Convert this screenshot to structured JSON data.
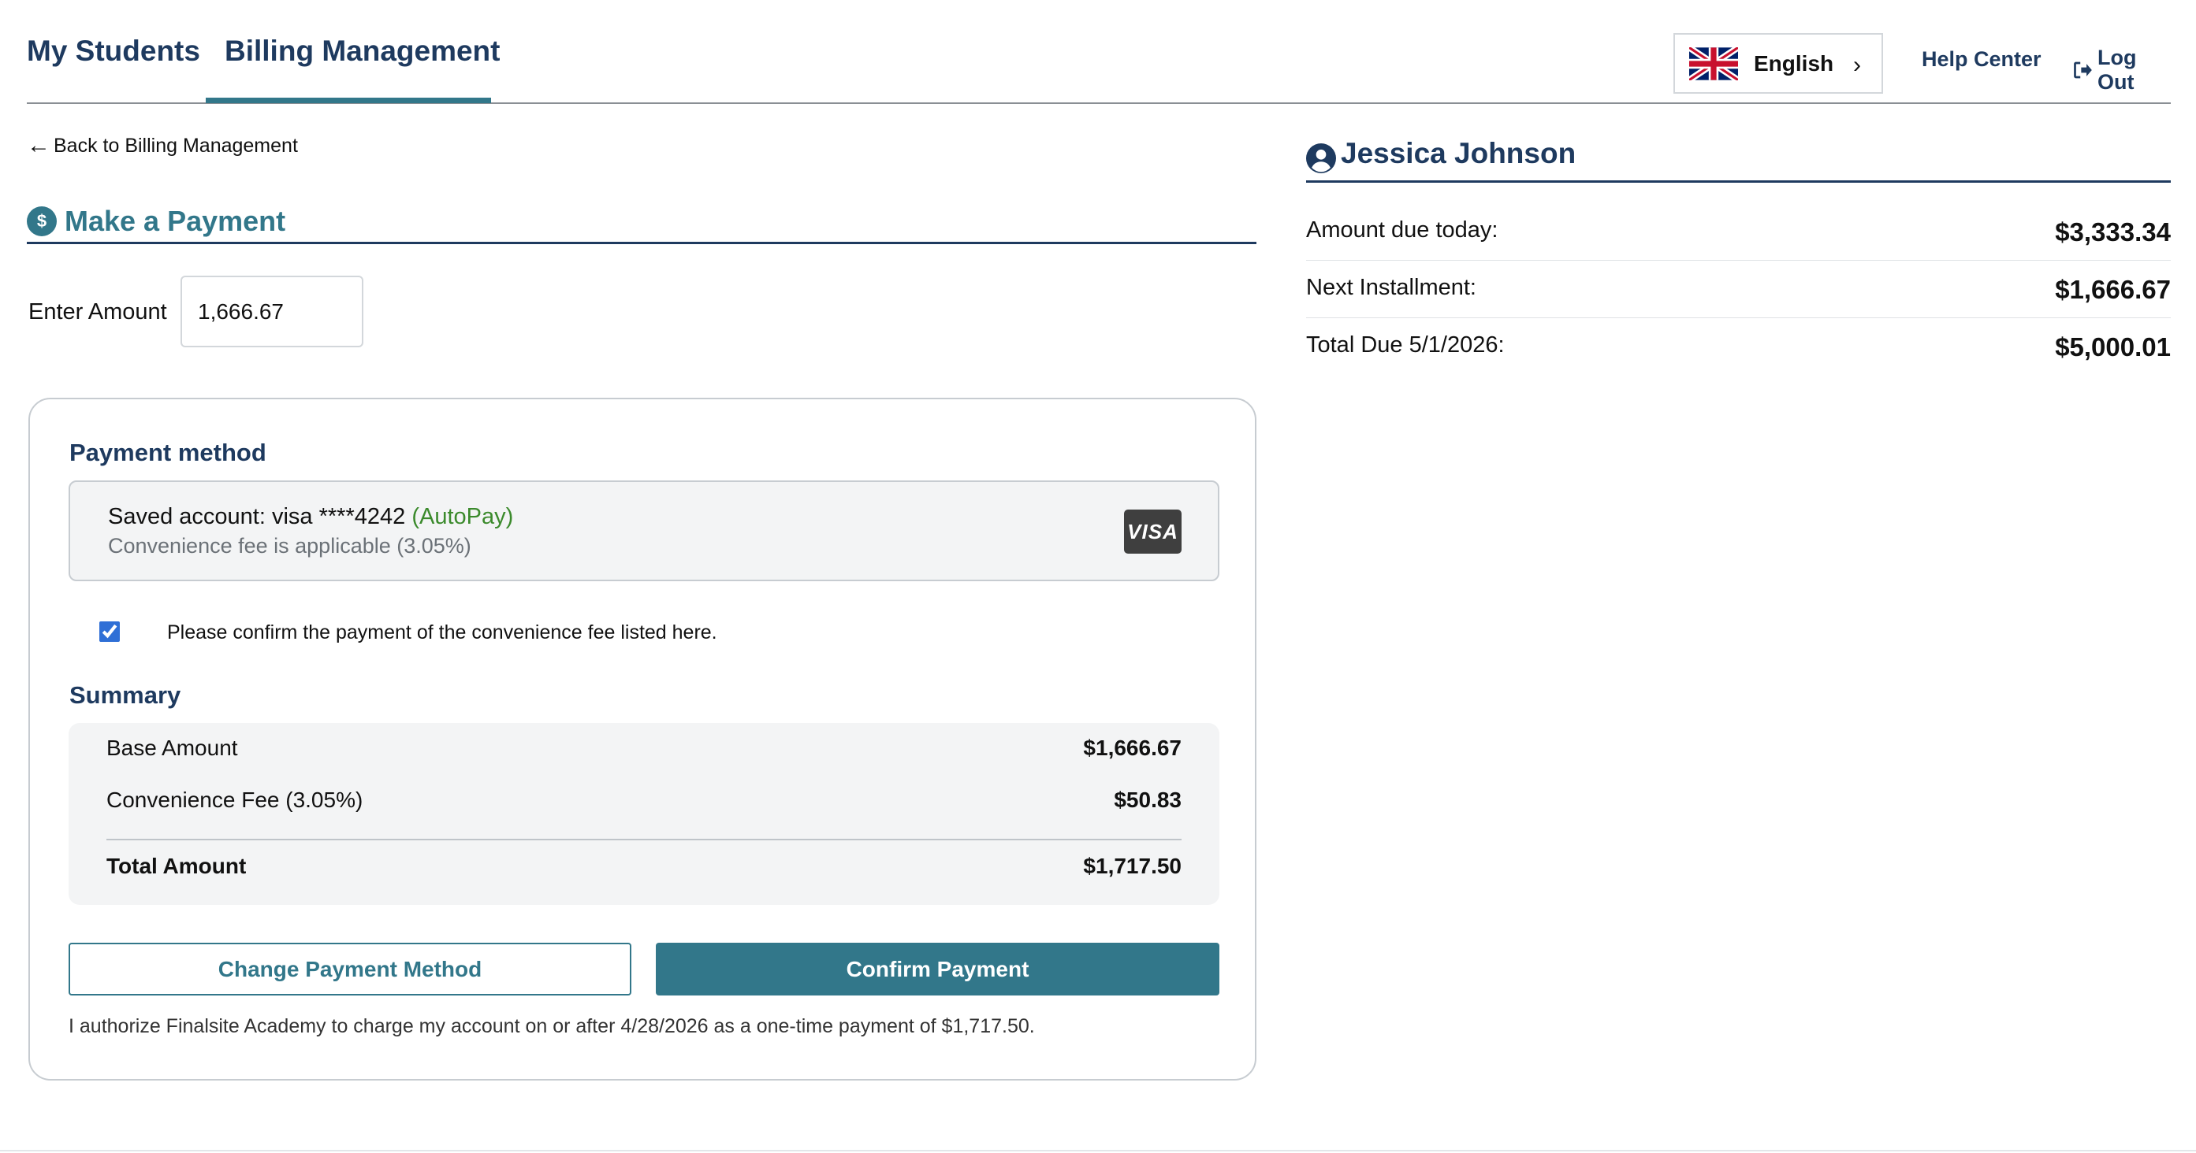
{
  "nav": {
    "tabs": [
      {
        "label": "My Students",
        "active": false
      },
      {
        "label": "Billing Management",
        "active": true
      }
    ],
    "language": {
      "label": "English",
      "flag_icon": "uk-flag-icon"
    },
    "help_label": "Help Center",
    "logout_label": "Log Out"
  },
  "back_link": {
    "label": "Back to Billing Management"
  },
  "payment": {
    "title": "Make a Payment",
    "amount_label": "Enter Amount",
    "amount_value": "1,666.67",
    "method_title": "Payment method",
    "saved_account": "Saved account: visa ****4242",
    "autopay": "(AutoPay)",
    "fee_note": "Convenience fee is applicable (3.05%)",
    "card_brand": "VISA",
    "confirm_fee_text": "Please confirm the payment of the convenience fee listed here.",
    "confirm_fee_checked": true,
    "summary_title": "Summary",
    "summary": {
      "base_label": "Base Amount",
      "base_value": "$1,666.67",
      "fee_label": "Convenience Fee (3.05%)",
      "fee_value": "$50.83",
      "total_label": "Total Amount",
      "total_value": "$1,717.50"
    },
    "change_method_label": "Change Payment Method",
    "confirm_label": "Confirm Payment",
    "authorization": "I authorize Finalsite Academy to charge my account on or after 4/28/2026 as a one-time payment of $1,717.50."
  },
  "student": {
    "name": "Jessica Johnson",
    "balances": [
      {
        "label": "Amount due today:",
        "amount": "$3,333.34"
      },
      {
        "label": "Next Installment:",
        "amount": "$1,666.67"
      },
      {
        "label": "Total Due 5/1/2026:",
        "amount": "$5,000.01"
      }
    ]
  },
  "colors": {
    "primary": "#32778a",
    "navy": "#1e3a5f",
    "autopay_green": "#3b8a2c"
  }
}
